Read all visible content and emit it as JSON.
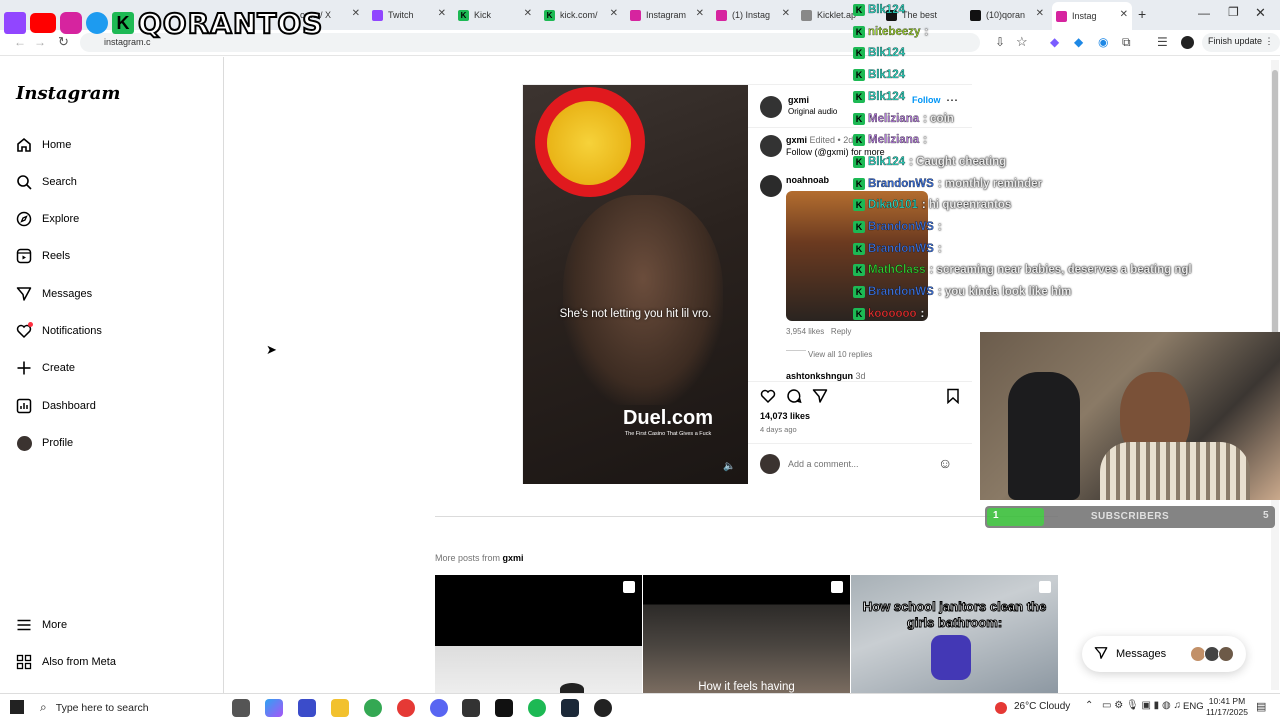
{
  "overlay": {
    "streamer_name": "QORANTOS"
  },
  "browser": {
    "tabs": [
      {
        "label": "ome / X",
        "icon": "x-icon"
      },
      {
        "label": "Twitch",
        "icon": "twitch-icon"
      },
      {
        "label": "Kick",
        "icon": "kick-icon"
      },
      {
        "label": "kick.com/",
        "icon": "kick-icon"
      },
      {
        "label": "Instagram",
        "icon": "instagram-icon"
      },
      {
        "label": "(1) Instag",
        "icon": "instagram-icon"
      },
      {
        "label": "Kicklet.ap",
        "icon": "kicklet-icon"
      },
      {
        "label": "The best",
        "icon": "tiktok-icon"
      },
      {
        "label": "(10)qoran",
        "icon": "tiktok-icon"
      },
      {
        "label": "Instag",
        "icon": "instagram-icon"
      }
    ],
    "url": "instagram.c",
    "finish_update": "Finish update"
  },
  "sidebar": {
    "logo": "Instagram",
    "items": [
      {
        "label": "Home",
        "icon": "home-icon"
      },
      {
        "label": "Search",
        "icon": "search-icon"
      },
      {
        "label": "Explore",
        "icon": "compass-icon"
      },
      {
        "label": "Reels",
        "icon": "reels-icon"
      },
      {
        "label": "Messages",
        "icon": "messenger-icon"
      },
      {
        "label": "Notifications",
        "icon": "heart-icon"
      },
      {
        "label": "Create",
        "icon": "plus-icon"
      },
      {
        "label": "Dashboard",
        "icon": "dashboard-icon"
      },
      {
        "label": "Profile",
        "icon": "avatar-icon"
      }
    ],
    "more": "More",
    "meta": "Also from Meta"
  },
  "post": {
    "video_caption": "She's not letting you hit lil vro.",
    "sponsor": "Duel.com",
    "sponsor_tagline": "The First Casino That Gives a Fuck",
    "author": "gxmi",
    "audio": "Original audio",
    "follow": "Follow",
    "caption_user": "gxmi",
    "caption_edited": "Edited • 2d",
    "caption_text": "Follow (@gxmi) for more",
    "commenter": "noahnoab",
    "comment_likes": "3,954 likes",
    "reply": "Reply",
    "view_replies": "View all 10 replies",
    "next_commenter": "ashtonkshngun",
    "next_time": "3d",
    "likes": "14,073 likes",
    "time_ago": "4 days ago",
    "comment_placeholder": "Add a comment..."
  },
  "more_posts": {
    "prefix": "More posts from",
    "user": "gxmi",
    "thumbs": [
      {
        "text": ""
      },
      {
        "text": "How it feels having"
      },
      {
        "text": "How school janitors clean the girls bathroom:"
      }
    ]
  },
  "chat": [
    {
      "user": "Blk124",
      "msg": "",
      "color": "#2dd4bf"
    },
    {
      "user": "nitebeezy",
      "msg": ":",
      "color": "#9acd32"
    },
    {
      "user": "Blk124",
      "msg": "",
      "color": "#2dd4bf"
    },
    {
      "user": "Blk124",
      "msg": "",
      "color": "#2dd4bf"
    },
    {
      "user": "Blk124",
      "msg": "",
      "color": "#2dd4bf"
    },
    {
      "user": "Meliziana",
      "msg": ": coin",
      "color": "#b57edc"
    },
    {
      "user": "Meliziana",
      "msg": ":",
      "color": "#b57edc"
    },
    {
      "user": "Blk124",
      "msg": ": Caught cheating",
      "color": "#2dd4bf"
    },
    {
      "user": "BrandonWS",
      "msg": ": monthly reminder",
      "color": "#3b6fd8"
    },
    {
      "user": "Dika0101",
      "msg": ": hi queenrantos",
      "color": "#2dd4bf"
    },
    {
      "user": "BrandonWS",
      "msg": ":",
      "color": "#3b6fd8"
    },
    {
      "user": "BrandonWS",
      "msg": ":",
      "color": "#3b6fd8"
    },
    {
      "user": "MathClass",
      "msg": ": screaming near babies, deserves a beating ngl",
      "color": "#32cd32"
    },
    {
      "user": "BrandonWS",
      "msg": ": you kinda look like him",
      "color": "#3b6fd8"
    },
    {
      "user": "koooooo",
      "msg": ":",
      "color": "#e03030"
    }
  ],
  "subs": {
    "current": "1",
    "label": "SUBSCRIBERS",
    "goal": "5",
    "progress": 0.2
  },
  "messages_pill": "Messages",
  "taskbar": {
    "search": "Type here to search",
    "weather": "26°C  Cloudy",
    "lang": "ENG",
    "time": "10:41 PM",
    "date": "11/17/2025"
  }
}
